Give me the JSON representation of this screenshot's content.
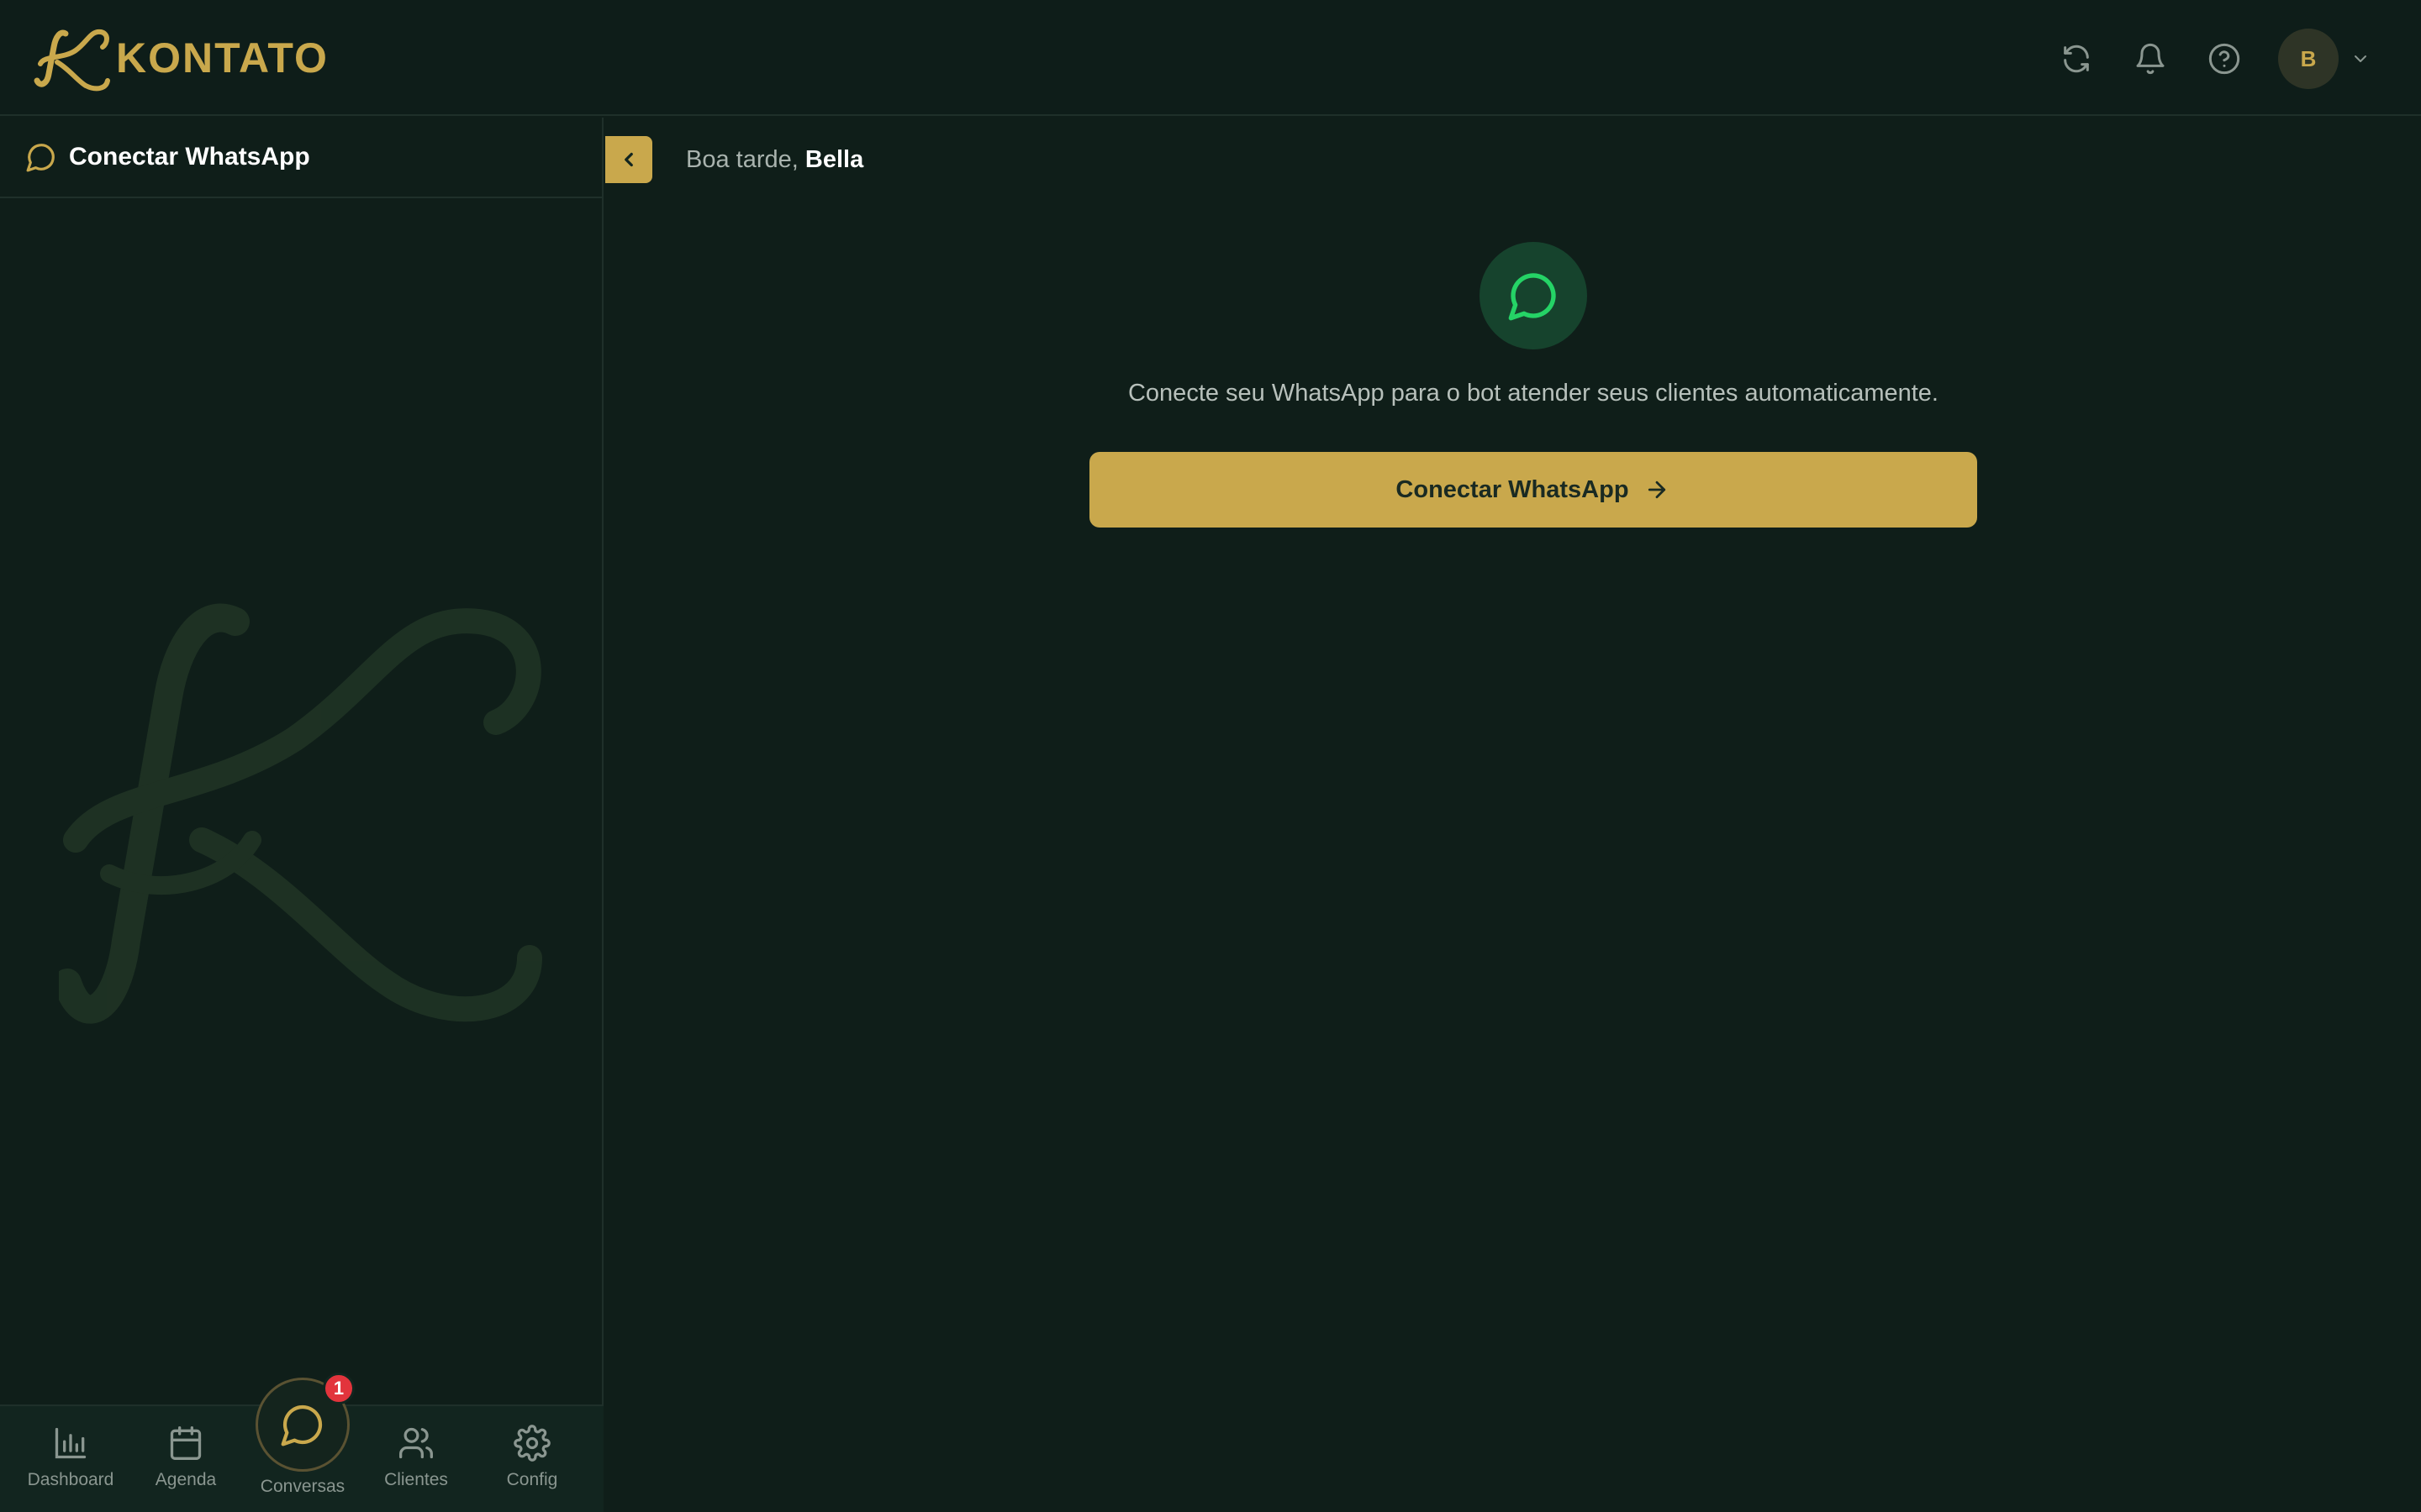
{
  "brand": {
    "name": "KONTATO"
  },
  "topbar": {
    "icons": [
      "refresh-icon",
      "bell-icon",
      "help-icon"
    ],
    "avatar_initial": "B"
  },
  "sidebar": {
    "header_title": "Conectar WhatsApp",
    "bottom_nav": [
      {
        "label": "Dashboard",
        "icon": "bar-chart-icon"
      },
      {
        "label": "Agenda",
        "icon": "calendar-icon"
      },
      {
        "label": "Conversas",
        "icon": "chat-icon",
        "badge": "1",
        "active": true
      },
      {
        "label": "Clientes",
        "icon": "users-icon"
      },
      {
        "label": "Config",
        "icon": "gear-icon"
      }
    ]
  },
  "main": {
    "greeting_prefix": "Boa tarde,",
    "greeting_name": "Bella",
    "description": "Conecte seu WhatsApp para o bot atender seus clientes automaticamente.",
    "connect_button": "Conectar WhatsApp"
  },
  "colors": {
    "accent": "#c9a84c",
    "background": "#0f1e19",
    "whatsapp_green": "#25d366",
    "badge_red": "#e2343c"
  }
}
